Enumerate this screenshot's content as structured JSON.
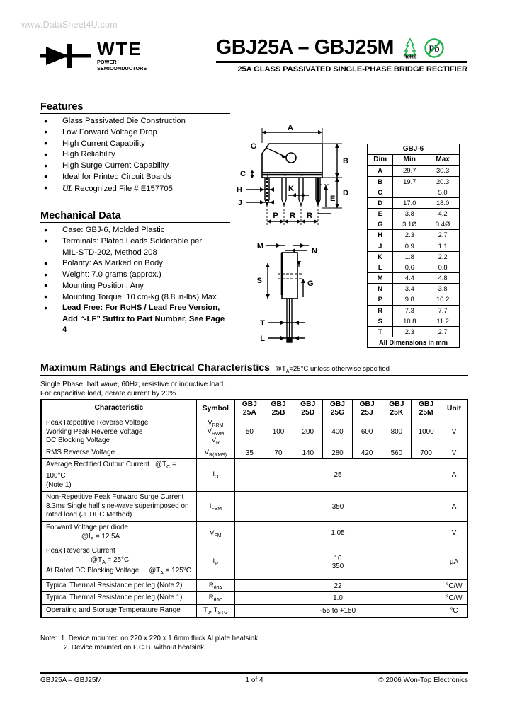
{
  "watermark": "www.DataSheet4U.com",
  "logo": {
    "name": "WTE",
    "tagline": "POWER SEMICONDUCTORS",
    "mark": "diode-symbol"
  },
  "header": {
    "title": "GBJ25A – GBJ25M",
    "subtitle": "25A GLASS PASSIVATED SINGLE-PHASE BRIDGE RECTIFIER",
    "marks": [
      {
        "name": "rohs-tree-icon",
        "label": "RoHS",
        "color": "#22b14c"
      },
      {
        "name": "lead-free-icon",
        "label": "Pb",
        "color": "#22b14c"
      }
    ]
  },
  "features": {
    "heading": "Features",
    "items": [
      "Glass Passivated Die Construction",
      "Low Forward Voltage Drop",
      "High Current Capability",
      "High Reliability",
      "High Surge Current Capability",
      "Ideal for Printed Circuit Boards",
      "Recognized File # E157705"
    ],
    "ul_mark": "UL"
  },
  "mechanical": {
    "heading": "Mechanical Data",
    "items": [
      {
        "text": "Case: GBJ-6, Molded Plastic",
        "bold": false
      },
      {
        "text": "Terminals: Plated Leads Solderable per",
        "bold": false
      },
      {
        "text": "MIL-STD-202, Method 208",
        "bold": false,
        "continuation": true
      },
      {
        "text": "Polarity: As Marked on Body",
        "bold": false
      },
      {
        "text": "Weight: 7.0 grams (approx.)",
        "bold": false
      },
      {
        "text": "Mounting Position: Any",
        "bold": false
      },
      {
        "text": "Mounting Torque: 10 cm-kg (8.8 in-lbs) Max.",
        "bold": false
      },
      {
        "text": "Lead Free: For RoHS / Lead Free Version,",
        "bold": true
      },
      {
        "text": "Add “-LF” Suffix to Part Number, See Page 4",
        "bold": true,
        "continuation": true
      }
    ]
  },
  "drawing": {
    "labels": [
      "A",
      "B",
      "C",
      "D",
      "E",
      "G",
      "H",
      "J",
      "K",
      "P",
      "R",
      "R",
      "M",
      "N",
      "S",
      "T",
      "L",
      "G"
    ],
    "polarity_plus": "+",
    "polarity_tilde1": "~",
    "polarity_tilde2": "~"
  },
  "dim_table": {
    "title": "GBJ-6",
    "columns": [
      "Dim",
      "Min",
      "Max"
    ],
    "rows": [
      {
        "dim": "A",
        "min": "29.7",
        "max": "30.3"
      },
      {
        "dim": "B",
        "min": "19.7",
        "max": "20.3"
      },
      {
        "dim": "C",
        "min": "",
        "max": "5.0"
      },
      {
        "dim": "D",
        "min": "17.0",
        "max": "18.0"
      },
      {
        "dim": "E",
        "min": "3.8",
        "max": "4.2"
      },
      {
        "dim": "G",
        "min": "3.1Ø",
        "max": "3.4Ø"
      },
      {
        "dim": "H",
        "min": "2.3",
        "max": "2.7"
      },
      {
        "dim": "J",
        "min": "0.9",
        "max": "1.1"
      },
      {
        "dim": "K",
        "min": "1.8",
        "max": "2.2"
      },
      {
        "dim": "L",
        "min": "0.6",
        "max": "0.8"
      },
      {
        "dim": "M",
        "min": "4.4",
        "max": "4.8"
      },
      {
        "dim": "N",
        "min": "3.4",
        "max": "3.8"
      },
      {
        "dim": "P",
        "min": "9.8",
        "max": "10.2"
      },
      {
        "dim": "R",
        "min": "7.3",
        "max": "7.7"
      },
      {
        "dim": "S",
        "min": "10.8",
        "max": "11.2"
      },
      {
        "dim": "T",
        "min": "2.3",
        "max": "2.7"
      }
    ],
    "footer": "All Dimensions in mm"
  },
  "max_ratings": {
    "heading": "Maximum Ratings and Electrical Characteristics",
    "condition": "@TA=25°C unless otherwise specified",
    "notes_above": [
      "Single Phase, half wave, 60Hz, resistive or inductive load.",
      "For capacitive load, derate current by 20%."
    ],
    "columns": {
      "characteristic": "Characteristic",
      "symbol": "Symbol",
      "parts": [
        "GBJ\n25A",
        "GBJ\n25B",
        "GBJ\n25D",
        "GBJ\n25G",
        "GBJ\n25J",
        "GBJ\n25K",
        "GBJ\n25M"
      ],
      "unit": "Unit"
    },
    "rows": [
      {
        "characteristic_lines": [
          "Peak Repetitive Reverse Voltage",
          "Working Peak Reverse Voltage",
          "DC Blocking Voltage"
        ],
        "symbol_lines": [
          "VRRM",
          "VRWM",
          "VR"
        ],
        "values": [
          "50",
          "100",
          "200",
          "400",
          "600",
          "800",
          "1000"
        ],
        "unit": "V"
      },
      {
        "characteristic_lines": [
          "RMS Reverse Voltage"
        ],
        "symbol_lines": [
          "VR(RMS)"
        ],
        "values": [
          "35",
          "70",
          "140",
          "280",
          "420",
          "560",
          "700"
        ],
        "unit": "V"
      },
      {
        "characteristic_lines": [
          "Average Rectified Output Current   @TC = 100°C",
          "(Note 1)"
        ],
        "symbol_lines": [
          "IO"
        ],
        "span_value": "25",
        "unit": "A"
      },
      {
        "characteristic_lines": [
          "Non-Repetitive Peak Forward Surge Current",
          "8.3ms Single half sine-wave superimposed on",
          "rated load (JEDEC Method)"
        ],
        "symbol_lines": [
          "IFSM"
        ],
        "span_value": "350",
        "unit": "A"
      },
      {
        "characteristic_lines": [
          "Forward Voltage per diode            @IF = 12.5A"
        ],
        "symbol_lines": [
          "VFM"
        ],
        "span_value": "1.05",
        "unit": "V"
      },
      {
        "characteristic_lines": [
          "Peak Reverse Current                     @TA = 25°C",
          "At Rated DC Blocking Voltage        @TA = 125°C"
        ],
        "symbol_lines": [
          "IR"
        ],
        "span_value": "10\n350",
        "unit": "µA"
      },
      {
        "characteristic_lines": [
          "Typical Thermal Resistance per leg (Note 2)"
        ],
        "symbol_lines": [
          "RθJA"
        ],
        "span_value": "22",
        "unit": "°C/W"
      },
      {
        "characteristic_lines": [
          "Typical Thermal Resistance per leg (Note 1)"
        ],
        "symbol_lines": [
          "RθJC"
        ],
        "span_value": "1.0",
        "unit": "°C/W"
      },
      {
        "characteristic_lines": [
          "Operating and Storage Temperature Range"
        ],
        "symbol_lines": [
          "TJ, TSTG"
        ],
        "span_value": "-55 to +150",
        "unit": "°C"
      }
    ]
  },
  "notes": {
    "label": "Note:",
    "items": [
      "1. Device mounted on 220 x 220 x 1.6mm thick Al plate heatsink.",
      "2. Device mounted on P.C.B. without heatsink."
    ]
  },
  "footer": {
    "left": "GBJ25A – GBJ25M",
    "center": "1 of 4",
    "right": "© 2006 Won-Top Electronics"
  }
}
